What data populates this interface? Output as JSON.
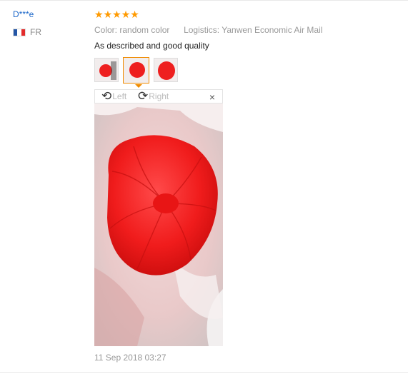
{
  "review": {
    "user": "D***e",
    "country_code": "FR",
    "flag_colors": [
      "#2456a6",
      "#ffffff",
      "#e22b2b"
    ],
    "rating": 5,
    "props": [
      {
        "key": "Color:",
        "value": "random color"
      },
      {
        "key": "Logistics:",
        "value": "Yanwen Economic Air Mail"
      }
    ],
    "feedback": "As described and good quality",
    "date": "11 Sep 2018 03:27"
  },
  "viewer": {
    "rotate_left": "Left",
    "rotate_right": "Right",
    "close": "×"
  },
  "colors": {
    "link": "#1a66c9",
    "star": "#ff9a00",
    "accent": "#f08b00",
    "product_red": "#ee1f1f"
  }
}
